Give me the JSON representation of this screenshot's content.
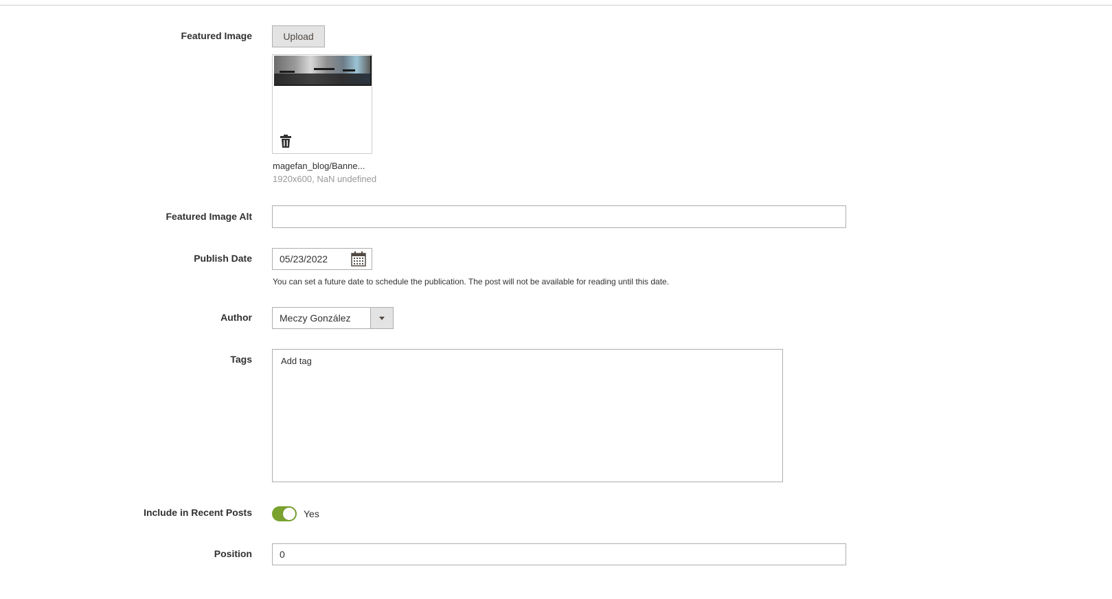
{
  "form": {
    "featured_image": {
      "label": "Featured Image",
      "upload_label": "Upload",
      "file_name": "magefan_blog/Banne...",
      "file_meta": "1920x600, NaN undefined"
    },
    "featured_image_alt": {
      "label": "Featured Image Alt",
      "value": ""
    },
    "publish_date": {
      "label": "Publish Date",
      "value": "05/23/2022",
      "note": "You can set a future date to schedule the publication. The post will not be available for reading until this date."
    },
    "author": {
      "label": "Author",
      "selected": "Meczy González"
    },
    "tags": {
      "label": "Tags",
      "placeholder": "Add tag"
    },
    "include_in_recent_posts": {
      "label": "Include in Recent Posts",
      "state": "Yes",
      "enabled": true
    },
    "position": {
      "label": "Position",
      "value": "0"
    }
  },
  "icons": {
    "delete": "trash-icon",
    "calendar": "calendar-icon",
    "dropdown": "caret-down-icon"
  },
  "colors": {
    "toggle_on": "#79a22e",
    "button_bg": "#e3e3e3",
    "border": "#adadad"
  }
}
